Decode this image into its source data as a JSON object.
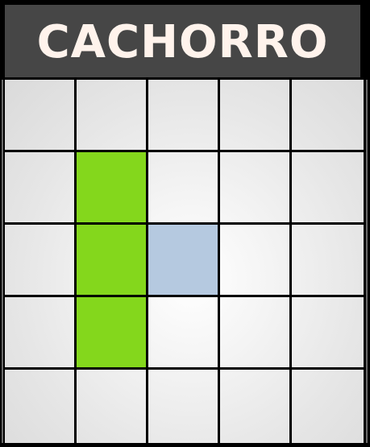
{
  "header": {
    "title": "CACHORRO"
  },
  "grid": {
    "rows": 5,
    "cols": 5,
    "cells": [
      [
        "empty",
        "empty",
        "empty",
        "empty",
        "empty"
      ],
      [
        "empty",
        "green",
        "empty",
        "empty",
        "empty"
      ],
      [
        "empty",
        "green",
        "blue",
        "empty",
        "empty"
      ],
      [
        "empty",
        "green",
        "empty",
        "empty",
        "empty"
      ],
      [
        "empty",
        "empty",
        "empty",
        "empty",
        "empty"
      ]
    ]
  },
  "colors": {
    "header_bg": "#464646",
    "title_text": "#fff3ec",
    "green": "#84d71c",
    "blue": "#b5c9e0",
    "grid_line": "#000000"
  }
}
